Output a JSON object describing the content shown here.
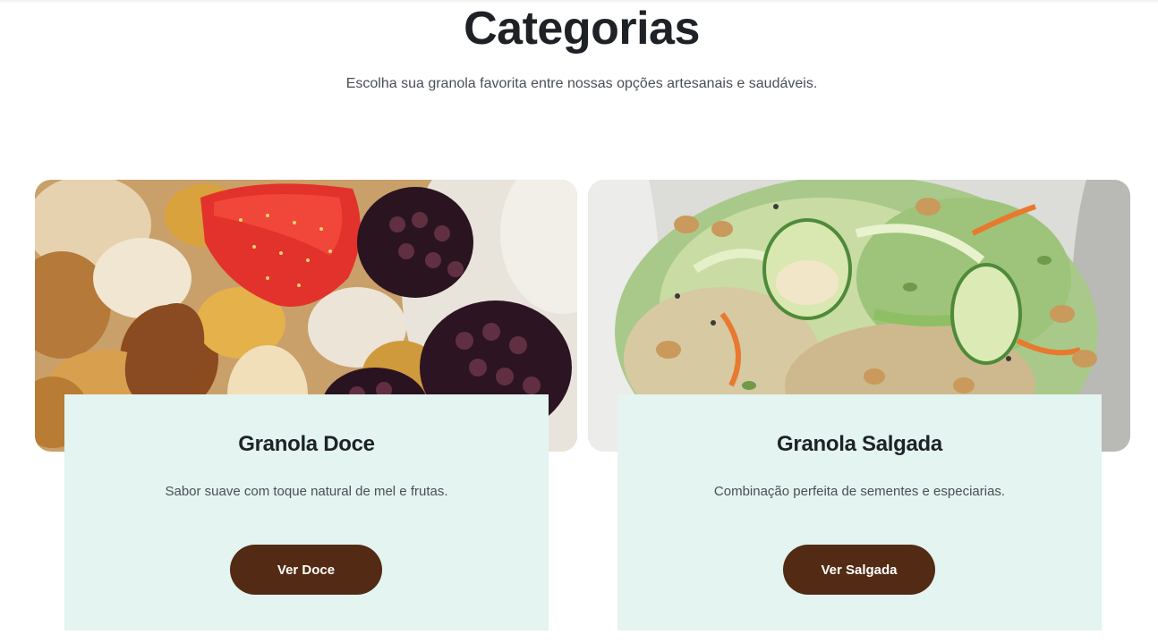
{
  "section": {
    "title": "Categorias",
    "subtitle": "Escolha sua granola favorita entre nossas opções artesanais e saudáveis."
  },
  "cards": [
    {
      "title": "Granola Doce",
      "description": "Sabor suave com toque natural de mel e frutas.",
      "button_label": "Ver Doce",
      "image": "granola-with-strawberry-and-blackberries-photo"
    },
    {
      "title": "Granola Salgada",
      "description": "Combinação perfeita de sementes e especiarias.",
      "button_label": "Ver Salgada",
      "image": "salad-with-granola-seeds-and-cucumber-photo"
    }
  ],
  "colors": {
    "button_bg": "#532a14",
    "panel_bg": "#e3f4f1",
    "heading": "#1e2226",
    "body_text": "#4a4f55"
  }
}
